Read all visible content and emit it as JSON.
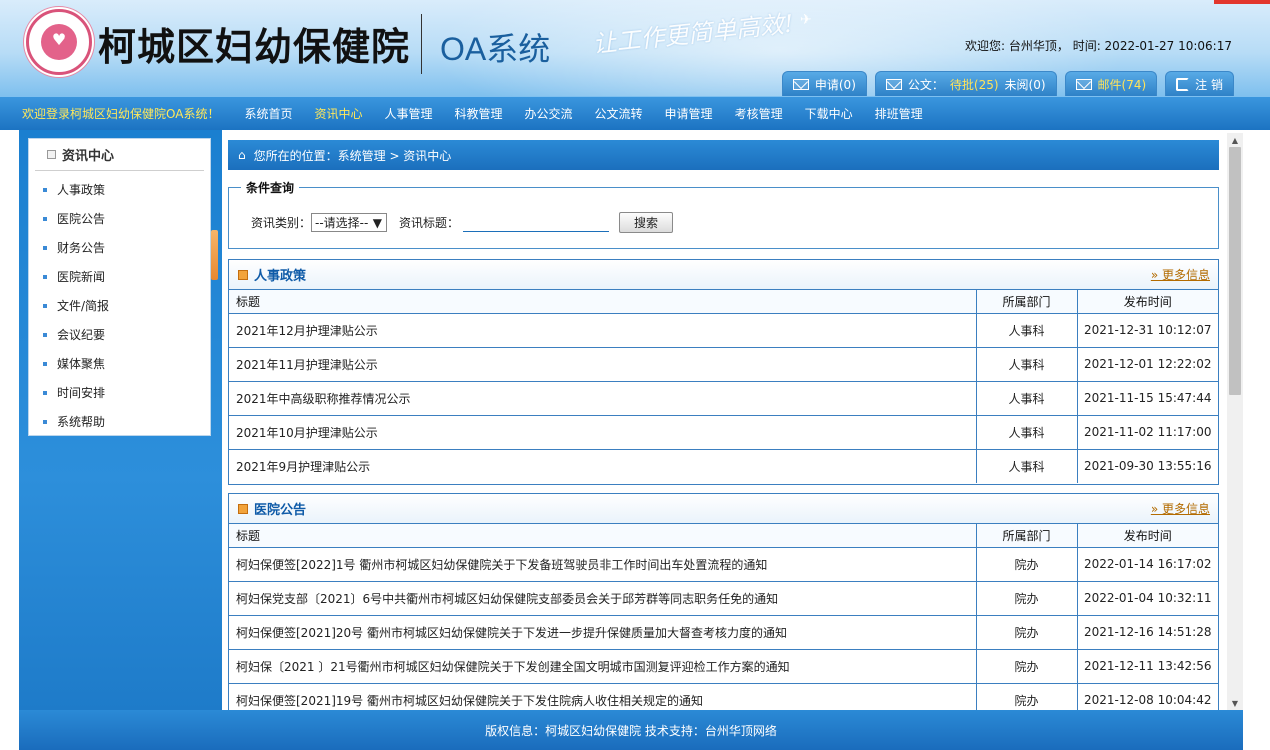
{
  "header": {
    "hospital_name": "柯城区妇幼保健院",
    "system_name": "OA系统",
    "slogan": "让工作更简单高效!",
    "welcome_text": "欢迎您: 台州华顶， 时间: 2022-01-27 10:06:17",
    "tabs": {
      "apply": "申请(0)",
      "doc_label": "公文：",
      "doc_pending": "待批(25)",
      "doc_unread": "未阅(0)",
      "mail": "邮件(74)",
      "logout": "注 销"
    }
  },
  "nav": {
    "welcome": "欢迎登录柯城区妇幼保健院OA系统！",
    "items": [
      "系统首页",
      "资讯中心",
      "人事管理",
      "科教管理",
      "办公交流",
      "公文流转",
      "申请管理",
      "考核管理",
      "下载中心",
      "排班管理"
    ],
    "active_index": 1
  },
  "sidebar": {
    "title": "资讯中心",
    "items": [
      "人事政策",
      "医院公告",
      "财务公告",
      "医院新闻",
      "文件/简报",
      "会议纪要",
      "媒体聚焦",
      "时间安排",
      "系统帮助"
    ]
  },
  "breadcrumb": "您所在的位置：系统管理 > 资讯中心",
  "query": {
    "legend": "条件查询",
    "category_label": "资讯类别：",
    "category_value": "--请选择--",
    "title_label": "资讯标题：",
    "title_value": "",
    "search_button": "搜索"
  },
  "columns": {
    "title": "标题",
    "dept": "所属部门",
    "time": "发布时间"
  },
  "sections": [
    {
      "title": "人事政策",
      "more": "» 更多信息",
      "rows": [
        [
          "2021年12月护理津贴公示",
          "人事科",
          "2021-12-31 10:12:07"
        ],
        [
          "2021年11月护理津贴公示",
          "人事科",
          "2021-12-01 12:22:02"
        ],
        [
          "2021年中高级职称推荐情况公示",
          "人事科",
          "2021-11-15 15:47:44"
        ],
        [
          "2021年10月护理津贴公示",
          "人事科",
          "2021-11-02 11:17:00"
        ],
        [
          "2021年9月护理津贴公示",
          "人事科",
          "2021-09-30 13:55:16"
        ]
      ]
    },
    {
      "title": "医院公告",
      "more": "» 更多信息",
      "rows": [
        [
          "柯妇保便签[2022]1号 衢州市柯城区妇幼保健院关于下发备班驾驶员非工作时间出车处置流程的通知",
          "院办",
          "2022-01-14 16:17:02"
        ],
        [
          "柯妇保党支部〔2021〕6号中共衢州市柯城区妇幼保健院支部委员会关于邱芳群等同志职务任免的通知",
          "院办",
          "2022-01-04 10:32:11"
        ],
        [
          "柯妇保便签[2021]20号 衢州市柯城区妇幼保健院关于下发进一步提升保健质量加大督查考核力度的通知",
          "院办",
          "2021-12-16 14:51:28"
        ],
        [
          "柯妇保〔2021 〕21号衢州市柯城区妇幼保健院关于下发创建全国文明城市国测复评迎检工作方案的通知",
          "院办",
          "2021-12-11 13:42:56"
        ],
        [
          "柯妇保便签[2021]19号 衢州市柯城区妇幼保健院关于下发住院病人收住相关规定的通知",
          "院办",
          "2021-12-08 10:04:42"
        ]
      ]
    }
  ],
  "footer": "版权信息：柯城区妇幼保健院 技术支持：台州华顶网络"
}
